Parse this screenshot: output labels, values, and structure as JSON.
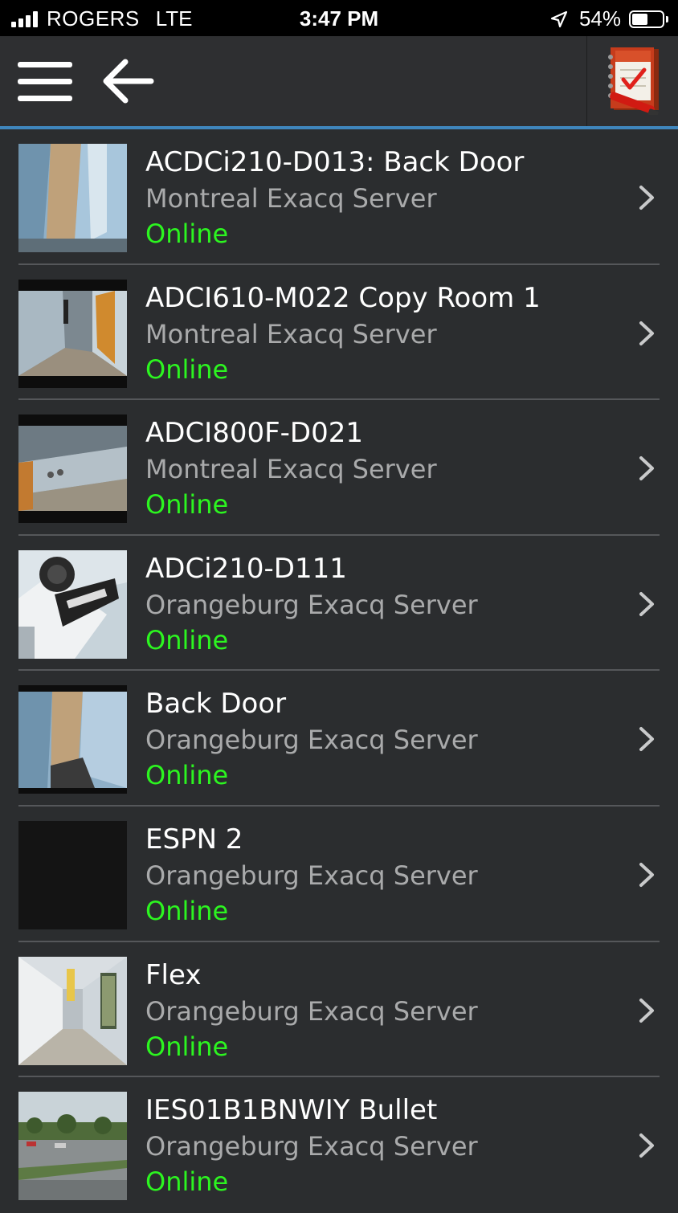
{
  "status_bar": {
    "carrier": "ROGERS",
    "network": "LTE",
    "time": "3:47 PM",
    "battery_text": "54%",
    "battery_level": 0.54
  },
  "nav": {
    "menu_icon": "hamburger-menu-icon",
    "back_icon": "back-arrow-icon",
    "logbook_icon": "logbook-icon",
    "accent_color": "#3f86bd"
  },
  "cameras": [
    {
      "name": "ACDCi210-D013: Back Door",
      "server": "Montreal Exacq Server",
      "status": "Online",
      "thumb": "hallway-door"
    },
    {
      "name": "ADCI610-M022 Copy Room 1",
      "server": "Montreal Exacq Server",
      "status": "Online",
      "thumb": "corridor-person"
    },
    {
      "name": "ADCI800F-D021",
      "server": "Montreal Exacq Server",
      "status": "Online",
      "thumb": "corridor-wall"
    },
    {
      "name": "ADCi210-D111",
      "server": "Orangeburg Exacq Server",
      "status": "Online",
      "thumb": "camera-closeup"
    },
    {
      "name": "Back Door",
      "server": "Orangeburg Exacq Server",
      "status": "Online",
      "thumb": "hallway-door"
    },
    {
      "name": "ESPN 2",
      "server": "Orangeburg Exacq Server",
      "status": "Online",
      "thumb": "black"
    },
    {
      "name": "Flex",
      "server": "Orangeburg Exacq Server",
      "status": "Online",
      "thumb": "long-hallway"
    },
    {
      "name": "IES01B1BNWIY Bullet",
      "server": "Orangeburg Exacq Server",
      "status": "Online",
      "thumb": "outdoor-parking"
    }
  ],
  "colors": {
    "online": "#2cf520",
    "subtitle": "#a9aaab",
    "background": "#2b2d2f"
  }
}
